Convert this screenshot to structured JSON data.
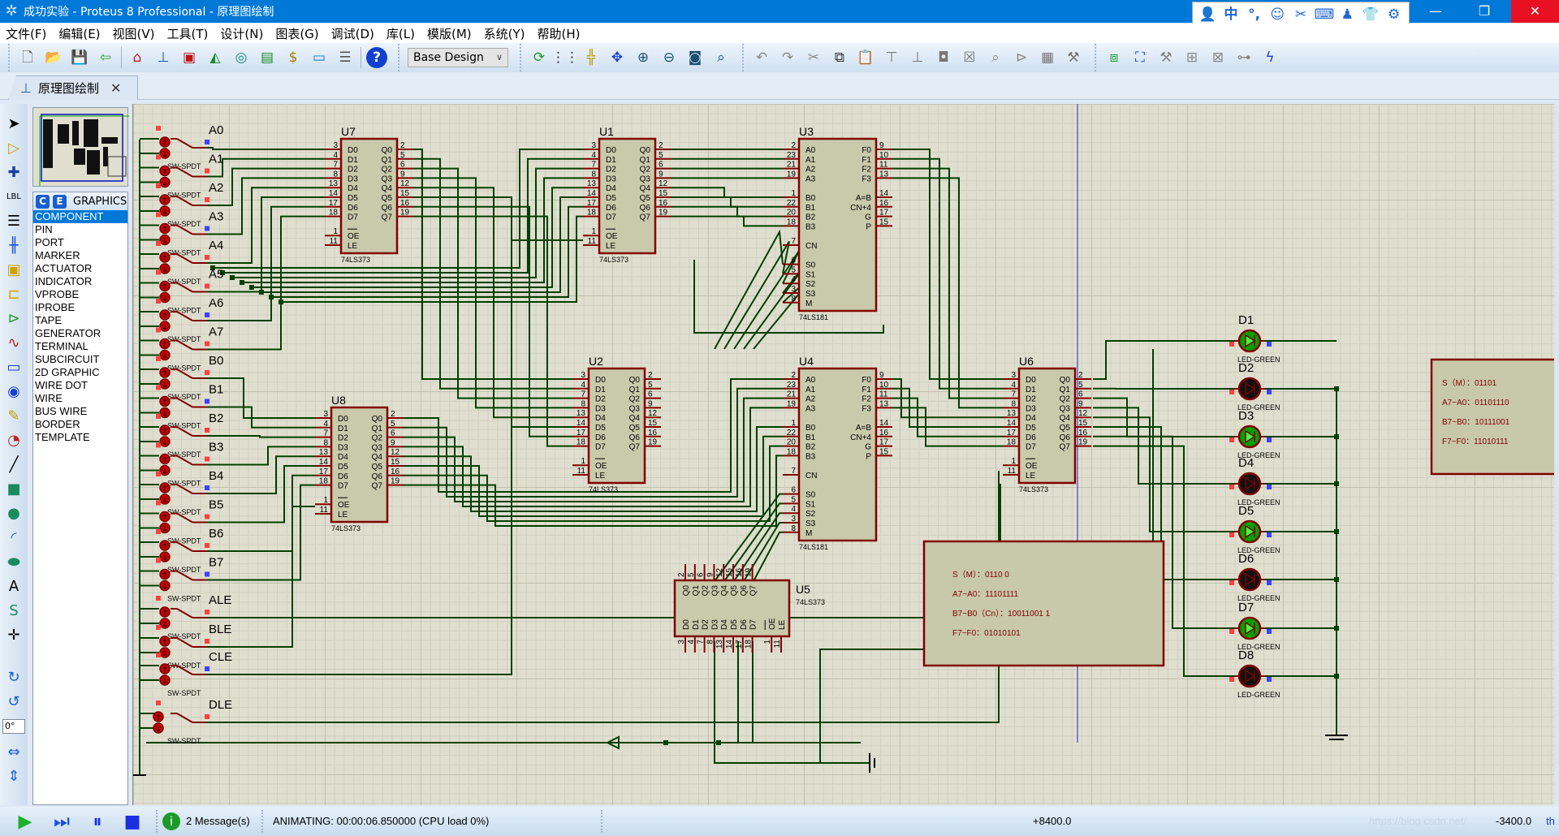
{
  "window": {
    "title": "成功实验 - Proteus 8 Professional - 原理图绘制",
    "app_icon": "proteus-icon",
    "tray_icons": [
      "user-icon",
      "中",
      "°,",
      "smile-icon",
      "scissors-icon",
      "keyboard-icon",
      "person-icon",
      "shirt-icon",
      "gear-icon"
    ],
    "controls": {
      "minimize": "—",
      "restore": "❐",
      "close": "✕"
    }
  },
  "menu": [
    "文件(F)",
    "编辑(E)",
    "视图(V)",
    "工具(T)",
    "设计(N)",
    "图表(G)",
    "调试(D)",
    "库(L)",
    "模版(M)",
    "系统(Y)",
    "帮助(H)"
  ],
  "toolbar": {
    "group1": [
      "new-icon",
      "open-icon",
      "save-icon",
      "close-project-icon"
    ],
    "group2": [
      "home-icon",
      "schematic-icon",
      "pcb-icon",
      "3d-viewer-icon",
      "gerber-viewer-icon",
      "design-explorer-icon",
      "bom-icon",
      "source-code-icon",
      "notes-icon"
    ],
    "help": "help-icon",
    "design_select": "Base Design",
    "group3": [
      "refresh-icon",
      "grid-icon",
      "origin-icon",
      "pan-icon",
      "zoom-in-icon",
      "zoom-out-icon",
      "zoom-all-icon",
      "zoom-area-icon"
    ],
    "group4": [
      "undo-icon",
      "redo-icon",
      "cut-icon",
      "copy-icon",
      "paste-icon",
      "block-copy-icon",
      "block-move-icon",
      "block-rotate-icon",
      "block-delete-icon",
      "pick-device-icon",
      "make-device-icon",
      "packaging-icon",
      "decompose-icon"
    ],
    "group5": [
      "wire-autorouter-icon",
      "search-icon",
      "property-assignment-icon",
      "new-sheet-icon",
      "remove-sheet-icon",
      "goto-child-icon",
      "electrical-rule-check-icon"
    ]
  },
  "tab": {
    "label": "原理图绘制",
    "icon": "schematic-icon",
    "close": "✕"
  },
  "left_tools": [
    "selection-mode-icon",
    "component-mode-icon",
    "junction-dot-icon",
    "wire-label-icon",
    "text-script-icon",
    "buses-icon",
    "subcircuit-icon",
    "terminals-icon",
    "device-pins-icon",
    "graph-icon",
    "active-popup-icon",
    "generator-icon",
    "probe-icon",
    "virtual-instruments-icon",
    "line-icon",
    "box-icon",
    "circle-icon",
    "arc-icon",
    "closed-path-icon",
    "text-icon",
    "symbol-icon",
    "marker-icon"
  ],
  "orientation": {
    "rotate_cw": "rotate-cw-icon",
    "rotate_ccw": "rotate-ccw-icon",
    "angle": "0°",
    "mirror_x": "mirror-horizontal-icon",
    "mirror_y": "mirror-vertical-icon"
  },
  "panel": {
    "btn_c": "C",
    "btn_e": "E",
    "title": "GRAPHICS",
    "selected": "COMPONENT",
    "items": [
      "COMPONENT",
      "PIN",
      "PORT",
      "MARKER",
      "ACTUATOR",
      "INDICATOR",
      "VPROBE",
      "IPROBE",
      "TAPE",
      "GENERATOR",
      "TERMINAL",
      "SUBCIRCUIT",
      "2D GRAPHIC",
      "WIRE DOT",
      "WIRE",
      "BUS WIRE",
      "BORDER",
      "TEMPLATE"
    ]
  },
  "schematic": {
    "colors": {
      "wire": "#004000",
      "pin": "#800000",
      "chip_fill": "#c9c9ab",
      "led_on": "#00a000",
      "led_off": "#111111"
    },
    "switches": {
      "type": "SW-SPDT",
      "labels": [
        "A0",
        "A1",
        "A2",
        "A3",
        "A4",
        "A5",
        "A6",
        "A7",
        "B0",
        "B1",
        "B2",
        "B3",
        "B4",
        "B5",
        "B6",
        "B7",
        "ALE",
        "BLE",
        "CLE",
        "DLE"
      ]
    },
    "chips": [
      {
        "ref": "U7",
        "type": "74LS373",
        "kind": "373"
      },
      {
        "ref": "U1",
        "type": "74LS373",
        "kind": "373"
      },
      {
        "ref": "U3",
        "type": "74LS181",
        "kind": "181"
      },
      {
        "ref": "U2",
        "type": "74LS373",
        "kind": "373"
      },
      {
        "ref": "U8",
        "type": "74LS373",
        "kind": "373"
      },
      {
        "ref": "U4",
        "type": "74LS181",
        "kind": "181"
      },
      {
        "ref": "U6",
        "type": "74LS373",
        "kind": "373"
      },
      {
        "ref": "U5",
        "type": "74LS373",
        "kind": "373"
      }
    ],
    "pinouts": {
      "373": {
        "left": [
          [
            "D0",
            "3"
          ],
          [
            "D1",
            "4"
          ],
          [
            "D2",
            "7"
          ],
          [
            "D3",
            "8"
          ],
          [
            "D4",
            "13"
          ],
          [
            "D5",
            "14"
          ],
          [
            "D6",
            "17"
          ],
          [
            "D7",
            "18"
          ],
          [
            "OE",
            "1"
          ],
          [
            "LE",
            "11"
          ]
        ],
        "right": [
          [
            "Q0",
            "2"
          ],
          [
            "Q1",
            "5"
          ],
          [
            "Q2",
            "6"
          ],
          [
            "Q3",
            "9"
          ],
          [
            "Q4",
            "12"
          ],
          [
            "Q5",
            "15"
          ],
          [
            "Q6",
            "16"
          ],
          [
            "Q7",
            "19"
          ]
        ]
      },
      "181": {
        "left": [
          [
            "A0",
            "2"
          ],
          [
            "A1",
            "23"
          ],
          [
            "A2",
            "21"
          ],
          [
            "A3",
            "19"
          ],
          [
            "B0",
            "1"
          ],
          [
            "B1",
            "22"
          ],
          [
            "B2",
            "20"
          ],
          [
            "B3",
            "18"
          ],
          [
            "CN",
            "7"
          ],
          [
            "S0",
            "6"
          ],
          [
            "S1",
            "5"
          ],
          [
            "S2",
            "4"
          ],
          [
            "S3",
            "3"
          ],
          [
            "M",
            "8"
          ]
        ],
        "right": [
          [
            "F0",
            "9"
          ],
          [
            "F1",
            "10"
          ],
          [
            "F2",
            "11"
          ],
          [
            "F3",
            "13"
          ],
          [
            "A=B",
            "14"
          ],
          [
            "CN+4",
            "16"
          ],
          [
            "G",
            "17"
          ],
          [
            "P",
            "15"
          ]
        ]
      }
    },
    "leds": [
      {
        "ref": "D1",
        "type": "LED-GREEN",
        "on": true
      },
      {
        "ref": "D2",
        "type": "LED-GREEN",
        "on": false
      },
      {
        "ref": "D3",
        "type": "LED-GREEN",
        "on": true
      },
      {
        "ref": "D4",
        "type": "LED-GREEN",
        "on": false
      },
      {
        "ref": "D5",
        "type": "LED-GREEN",
        "on": true
      },
      {
        "ref": "D6",
        "type": "LED-GREEN",
        "on": false
      },
      {
        "ref": "D7",
        "type": "LED-GREEN",
        "on": true
      },
      {
        "ref": "D8",
        "type": "LED-GREEN",
        "on": false
      }
    ],
    "notes": [
      [
        "S（M）：0110 0",
        "A7~A0：11101111",
        "B7~B0（Cn）：10011001 1",
        "F7~F0：01010101"
      ],
      [
        "S（M）：01101",
        "A7~A0：01101110",
        "B7~B0：10111001",
        "F7~F0：11010111"
      ]
    ]
  },
  "status": {
    "play": "play-icon",
    "step": "step-icon",
    "pause": "pause-icon",
    "stop": "stop-icon",
    "info_icon": "info-icon",
    "messages": "2 Message(s)",
    "animating": "ANIMATING: 00:00:06.850000 (CPU load 0%)",
    "x_coord": "+8400.0",
    "watermark": "https://blog.csdn.net/",
    "y_coord": "-3400.0",
    "unit": "th"
  }
}
